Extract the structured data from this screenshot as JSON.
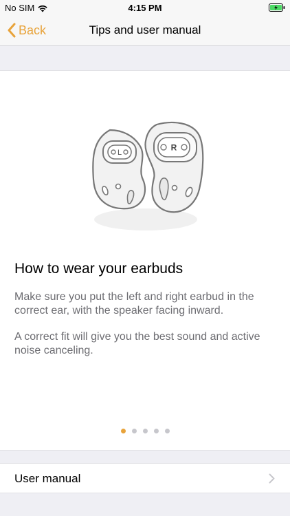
{
  "status_bar": {
    "carrier": "No SIM",
    "time": "4:15 PM",
    "wifi_icon": "wifi-icon",
    "battery_icon": "battery-charging-icon"
  },
  "nav": {
    "back_label": "Back",
    "title": "Tips and user manual",
    "accent_color": "#e8a33a"
  },
  "tip": {
    "earbud_left_mark": "L",
    "earbud_right_mark": "R",
    "heading": "How to wear your earbuds",
    "paragraph1": "Make sure you put the left and right earbud in the correct ear, with the speaker facing inward.",
    "paragraph2": "A correct fit will give you the best sound and active noise canceling."
  },
  "pager": {
    "count": 5,
    "active_index": 0
  },
  "manual_row": {
    "label": "User manual",
    "chevron_icon": "chevron-right-icon"
  }
}
